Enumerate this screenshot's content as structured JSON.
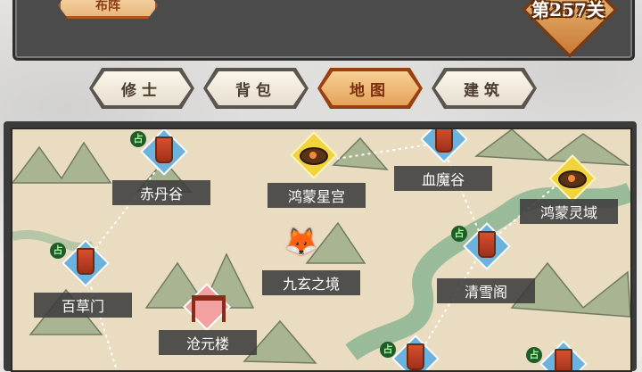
{
  "header": {
    "formation_label": "布阵",
    "level_label": "第257关"
  },
  "tabs": [
    {
      "label": "修士",
      "active": false
    },
    {
      "label": "背包",
      "active": false
    },
    {
      "label": "地图",
      "active": true
    },
    {
      "label": "建筑",
      "active": false
    }
  ],
  "map": {
    "locations": [
      {
        "name": "赤丹谷",
        "icon": "banner-icon",
        "style": "blue"
      },
      {
        "name": "鸿蒙星宫",
        "icon": "eye-icon",
        "style": "yellow"
      },
      {
        "name": "血魔谷",
        "icon": "banner-icon",
        "style": "blue"
      },
      {
        "name": "鸿蒙灵域",
        "icon": "eye-icon",
        "style": "yellow"
      },
      {
        "name": "百草门",
        "icon": "banner-icon",
        "style": "blue"
      },
      {
        "name": "九玄之境",
        "icon": "fox-icon",
        "style": "none"
      },
      {
        "name": "清雪阁",
        "icon": "banner-icon",
        "style": "blue"
      },
      {
        "name": "沧元楼",
        "icon": "gate-icon",
        "style": "pink"
      }
    ],
    "lock_glyph": "占"
  },
  "colors": {
    "accent": "#e6a35a",
    "panel": "#4b4b4b",
    "river": "#7fb08c"
  }
}
